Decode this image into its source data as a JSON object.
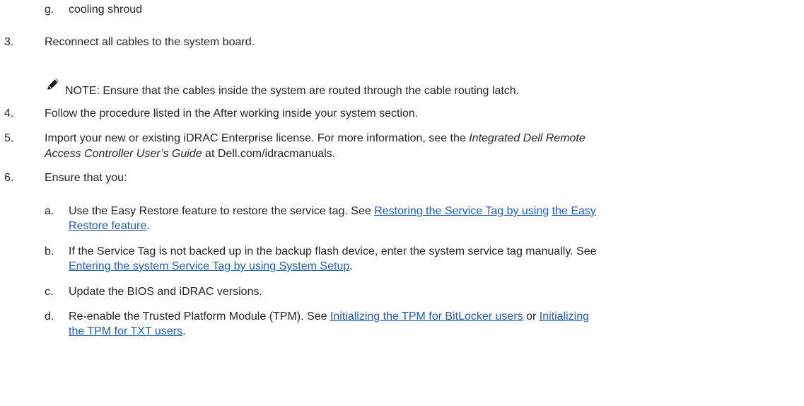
{
  "items": {
    "g": {
      "marker": "g.",
      "text": "cooling shroud"
    },
    "s3": {
      "marker": "3.",
      "text": "Reconnect all cables to the system board."
    },
    "note": {
      "icon": "pencil-note-icon",
      "text": "NOTE: Ensure that the cables inside the system are routed through the cable routing latch."
    },
    "s4": {
      "marker": "4.",
      "text": "Follow the procedure listed in the After working inside your system section."
    },
    "s5": {
      "marker": "5.",
      "line1_pre": "Import your new or existing iDRAC Enterprise license. For more information, see the ",
      "line1_em": "Integrated Dell Remote",
      "line2_em": "Access Controller User’s Guide",
      "line2_post": " at Dell.com/idracmanuals."
    },
    "s6": {
      "marker": "6.",
      "text": "Ensure that you:"
    },
    "a": {
      "marker": "a.",
      "line1_pre": "Use the Easy Restore feature to restore the service tag. See ",
      "link1": "Restoring the Service Tag by using",
      "sep": " ",
      "link2_line1": "the Easy",
      "link2_line2": "Restore feature",
      "line2_post": "."
    },
    "b": {
      "marker": "b.",
      "line1": "If the Service Tag is not backed up in the backup flash device, enter the system service tag manually. See",
      "link": "Entering the system Service Tag by using System Setup",
      "line2_post": "."
    },
    "c": {
      "marker": "c.",
      "text": "Update the BIOS and iDRAC versions."
    },
    "d": {
      "marker": "d.",
      "line1_pre": "Re-enable the Trusted Platform Module (TPM). See ",
      "link1": "Initializing the TPM for BitLocker users",
      "or": " or ",
      "link2_line1": "Initializing",
      "link2_line2": "the TPM for TXT users",
      "line2_post": "."
    }
  }
}
